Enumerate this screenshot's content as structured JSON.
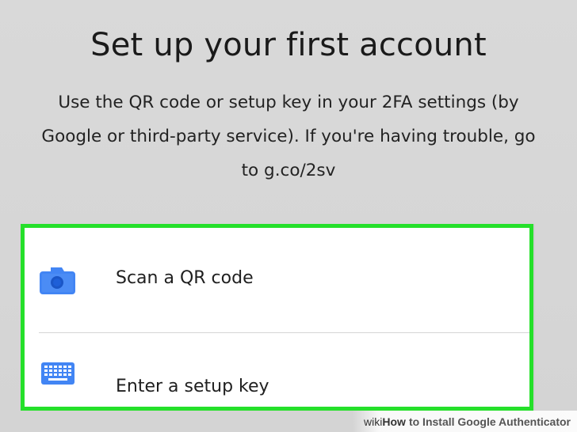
{
  "header": {
    "title": "Set up your first account",
    "subtitle_line1": "Use the QR code or setup key in your 2FA settings (by",
    "subtitle_line2": "Google or third-party service). If you're having trouble, go",
    "subtitle_line3": "to g.co/2sv"
  },
  "options": [
    {
      "label": "Scan a QR code",
      "icon": "camera-icon"
    },
    {
      "label": "Enter a setup key",
      "icon": "keyboard-icon"
    }
  ],
  "colors": {
    "highlight": "#25e02a",
    "icon_blue": "#4285f4",
    "background": "#d8d8d8"
  },
  "watermark": {
    "wiki": "wiki",
    "how": "How",
    "rest": "to Install Google Authenticator"
  }
}
